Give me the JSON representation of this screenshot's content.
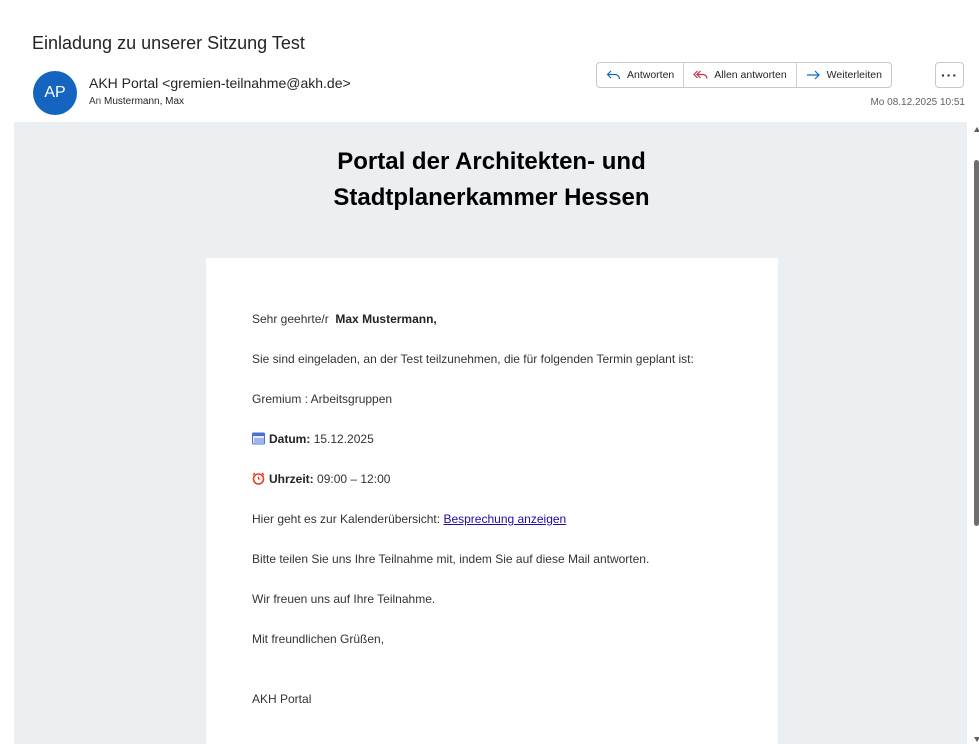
{
  "email": {
    "subject": "Einladung zu unserer Sitzung Test",
    "avatar_initials": "AP",
    "sender": "AKH Portal <gremien-teilnahme@akh.de>",
    "recipient_prefix": "An",
    "recipient_name": "Mustermann, Max",
    "date": "Mo 08.12.2025 10:51"
  },
  "actions": {
    "reply": "Antworten",
    "reply_all": "Allen antworten",
    "forward": "Weiterleiten",
    "more": "···"
  },
  "body": {
    "title_line1": "Portal der Architekten- und",
    "title_line2": "Stadtplanerkammer Hessen",
    "greeting_prefix": "Sehr geehrte/r",
    "greeting_name": "Max Mustermann,",
    "invite_text": "Sie sind eingeladen, an der Test teilzunehmen, die für folgenden Termin geplant ist:",
    "committee": "Gremium : Arbeitsgruppen",
    "date_label": "Datum:",
    "date_value": "15.12.2025",
    "time_label": "Uhrzeit:",
    "time_value": "09:00 – 12:00",
    "calendar_text": "Hier geht es zur Kalenderübersicht:",
    "calendar_link": "Besprechung anzeigen",
    "reply_request": "Bitte teilen Sie uns Ihre Teilnahme mit, indem Sie auf diese Mail antworten.",
    "looking_forward": "Wir freuen uns auf Ihre Teilnahme.",
    "closing": "Mit freundlichen Grüßen,",
    "signature": "AKH Portal"
  },
  "colors": {
    "avatar": "#1565c0",
    "body_background": "#eceff1",
    "link": "#1a0dab"
  },
  "icons": {
    "date": "calendar-icon",
    "time": "alarm-clock-icon"
  }
}
